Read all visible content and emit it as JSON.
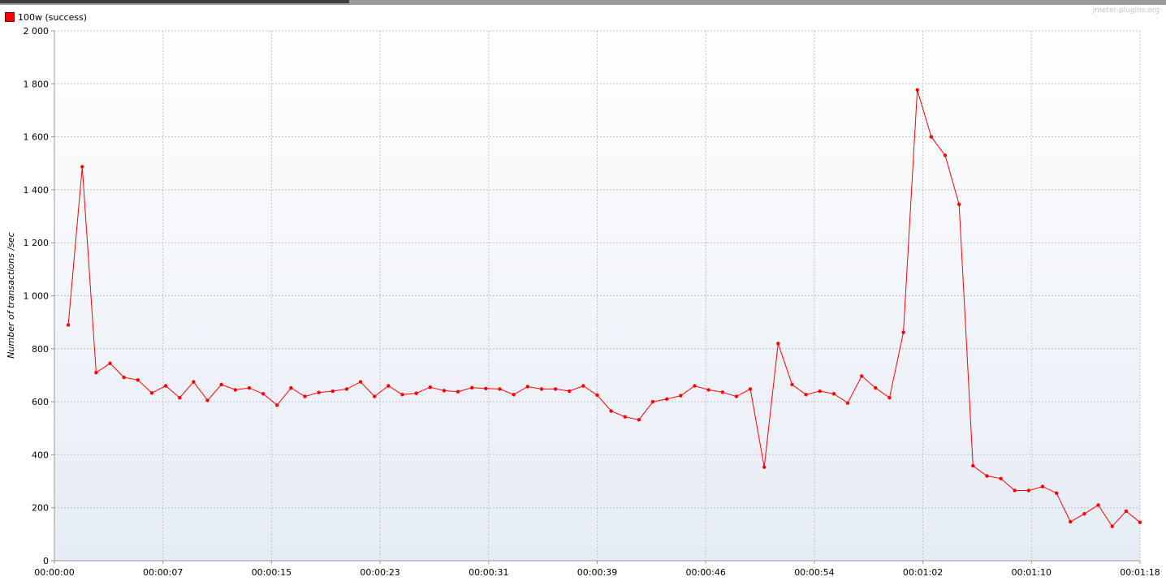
{
  "legend": {
    "label": "100w (success)",
    "color": "#ff0000"
  },
  "watermark": "jmeter-plugins.org",
  "chart_data": {
    "type": "line",
    "ylabel": "Number of transactions /sec",
    "ylim": [
      0,
      2000
    ],
    "yticks": [
      0,
      200,
      400,
      600,
      800,
      1000,
      1200,
      1400,
      1600,
      1800,
      2000
    ],
    "ytick_labels": [
      "0",
      "200",
      "400",
      "600",
      "800",
      "1 000",
      "1 200",
      "1 400",
      "1 600",
      "1 800",
      "2 000"
    ],
    "xlim": [
      0,
      78
    ],
    "xticks": [
      0,
      7.8,
      15.6,
      23.4,
      31.2,
      39,
      46.8,
      54.6,
      62.4,
      70.2,
      78
    ],
    "xtick_labels": [
      "00:00:00",
      "00:00:07",
      "00:00:15",
      "00:00:23",
      "00:00:31",
      "00:00:39",
      "00:00:46",
      "00:00:54",
      "00:01:02",
      "00:01:10",
      "00:01:18"
    ],
    "grid": true,
    "series": [
      {
        "name": "100w (success)",
        "color": "#ff0000",
        "x": [
          1,
          2,
          3,
          4,
          5,
          6,
          7,
          8,
          9,
          10,
          11,
          12,
          13,
          14,
          15,
          16,
          17,
          18,
          19,
          20,
          21,
          22,
          23,
          24,
          25,
          26,
          27,
          28,
          29,
          30,
          31,
          32,
          33,
          34,
          35,
          36,
          37,
          38,
          39,
          40,
          41,
          42,
          43,
          44,
          45,
          46,
          47,
          48,
          49,
          50,
          51,
          52,
          53,
          54,
          55,
          56,
          57,
          58,
          59,
          60,
          61,
          62,
          63,
          64,
          65,
          66,
          67,
          68,
          69,
          70,
          71,
          72,
          73,
          74,
          75,
          76,
          77,
          78
        ],
        "y": [
          890,
          1487,
          710,
          745,
          692,
          682,
          633,
          660,
          615,
          675,
          605,
          665,
          645,
          652,
          630,
          587,
          652,
          620,
          635,
          640,
          648,
          675,
          620,
          660,
          627,
          632,
          655,
          642,
          638,
          653,
          650,
          648,
          627,
          657,
          648,
          648,
          640,
          660,
          625,
          565,
          543,
          532,
          600,
          610,
          623,
          660,
          645,
          636,
          620,
          648,
          353,
          820,
          665,
          627,
          640,
          630,
          595,
          697,
          652,
          615,
          862,
          1777,
          1600,
          1530,
          1345,
          358,
          320,
          310,
          265,
          265,
          280,
          255,
          147,
          177,
          210,
          130,
          187,
          145
        ]
      }
    ]
  }
}
